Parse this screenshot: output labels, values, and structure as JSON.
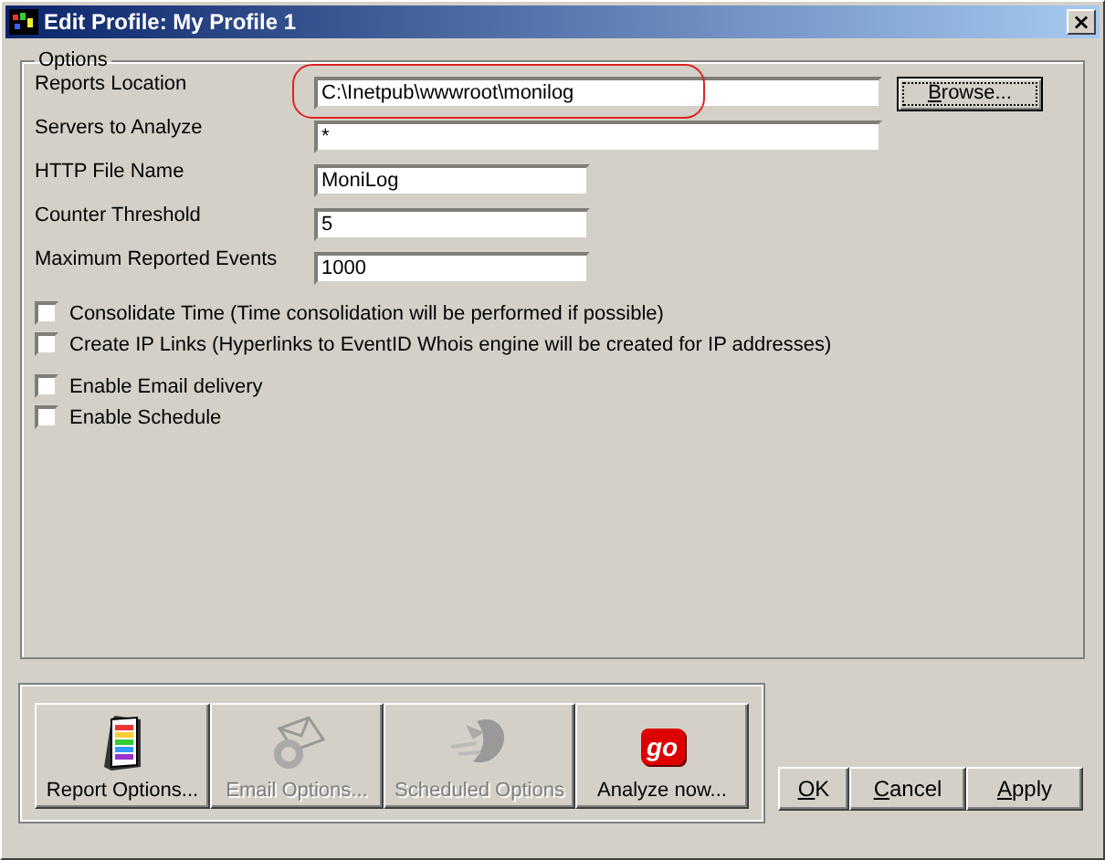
{
  "window": {
    "title": "Edit Profile: My Profile 1",
    "close": "×"
  },
  "options": {
    "title": "Options",
    "fields": [
      {
        "label": "Reports Location",
        "value": "C:\\Inetpub\\wwwroot\\monilog",
        "kind": "wide",
        "highlighted": true,
        "browse": {
          "accel": "B",
          "rest": "rowse..."
        }
      },
      {
        "label": "Servers to Analyze",
        "value": "*",
        "kind": "wide",
        "highlighted": false
      },
      {
        "label": "HTTP File Name",
        "value": "MoniLog",
        "kind": "narrow",
        "highlighted": false
      },
      {
        "label": "Counter Threshold",
        "value": "5",
        "kind": "narrow",
        "highlighted": false
      },
      {
        "label": "Maximum Reported Events",
        "value": "1000",
        "kind": "narrow",
        "highlighted": false
      }
    ],
    "check_groups": [
      [
        {
          "label": "Consolidate Time (Time consolidation will be performed if possible)",
          "checked": false
        },
        {
          "label": "Create IP Links (Hyperlinks to EventID Whois engine will be created for IP addresses)",
          "checked": false
        }
      ],
      [
        {
          "label": "Enable Email delivery",
          "checked": false
        },
        {
          "label": "Enable Schedule",
          "checked": false
        }
      ]
    ]
  },
  "toolbar": [
    {
      "kind": "report",
      "label": "Report Options...",
      "disabled": false
    },
    {
      "kind": "email",
      "label": "Email Options...",
      "disabled": true
    },
    {
      "kind": "schedule",
      "label": "Scheduled Options",
      "disabled": true
    },
    {
      "kind": "go",
      "label": "Analyze now...",
      "disabled": false,
      "icon_text": "go"
    }
  ],
  "buttons": [
    {
      "accel": "O",
      "rest": "K"
    },
    {
      "accel": "C",
      "rest": "ancel"
    },
    {
      "accel": "A",
      "rest": "pply"
    }
  ]
}
